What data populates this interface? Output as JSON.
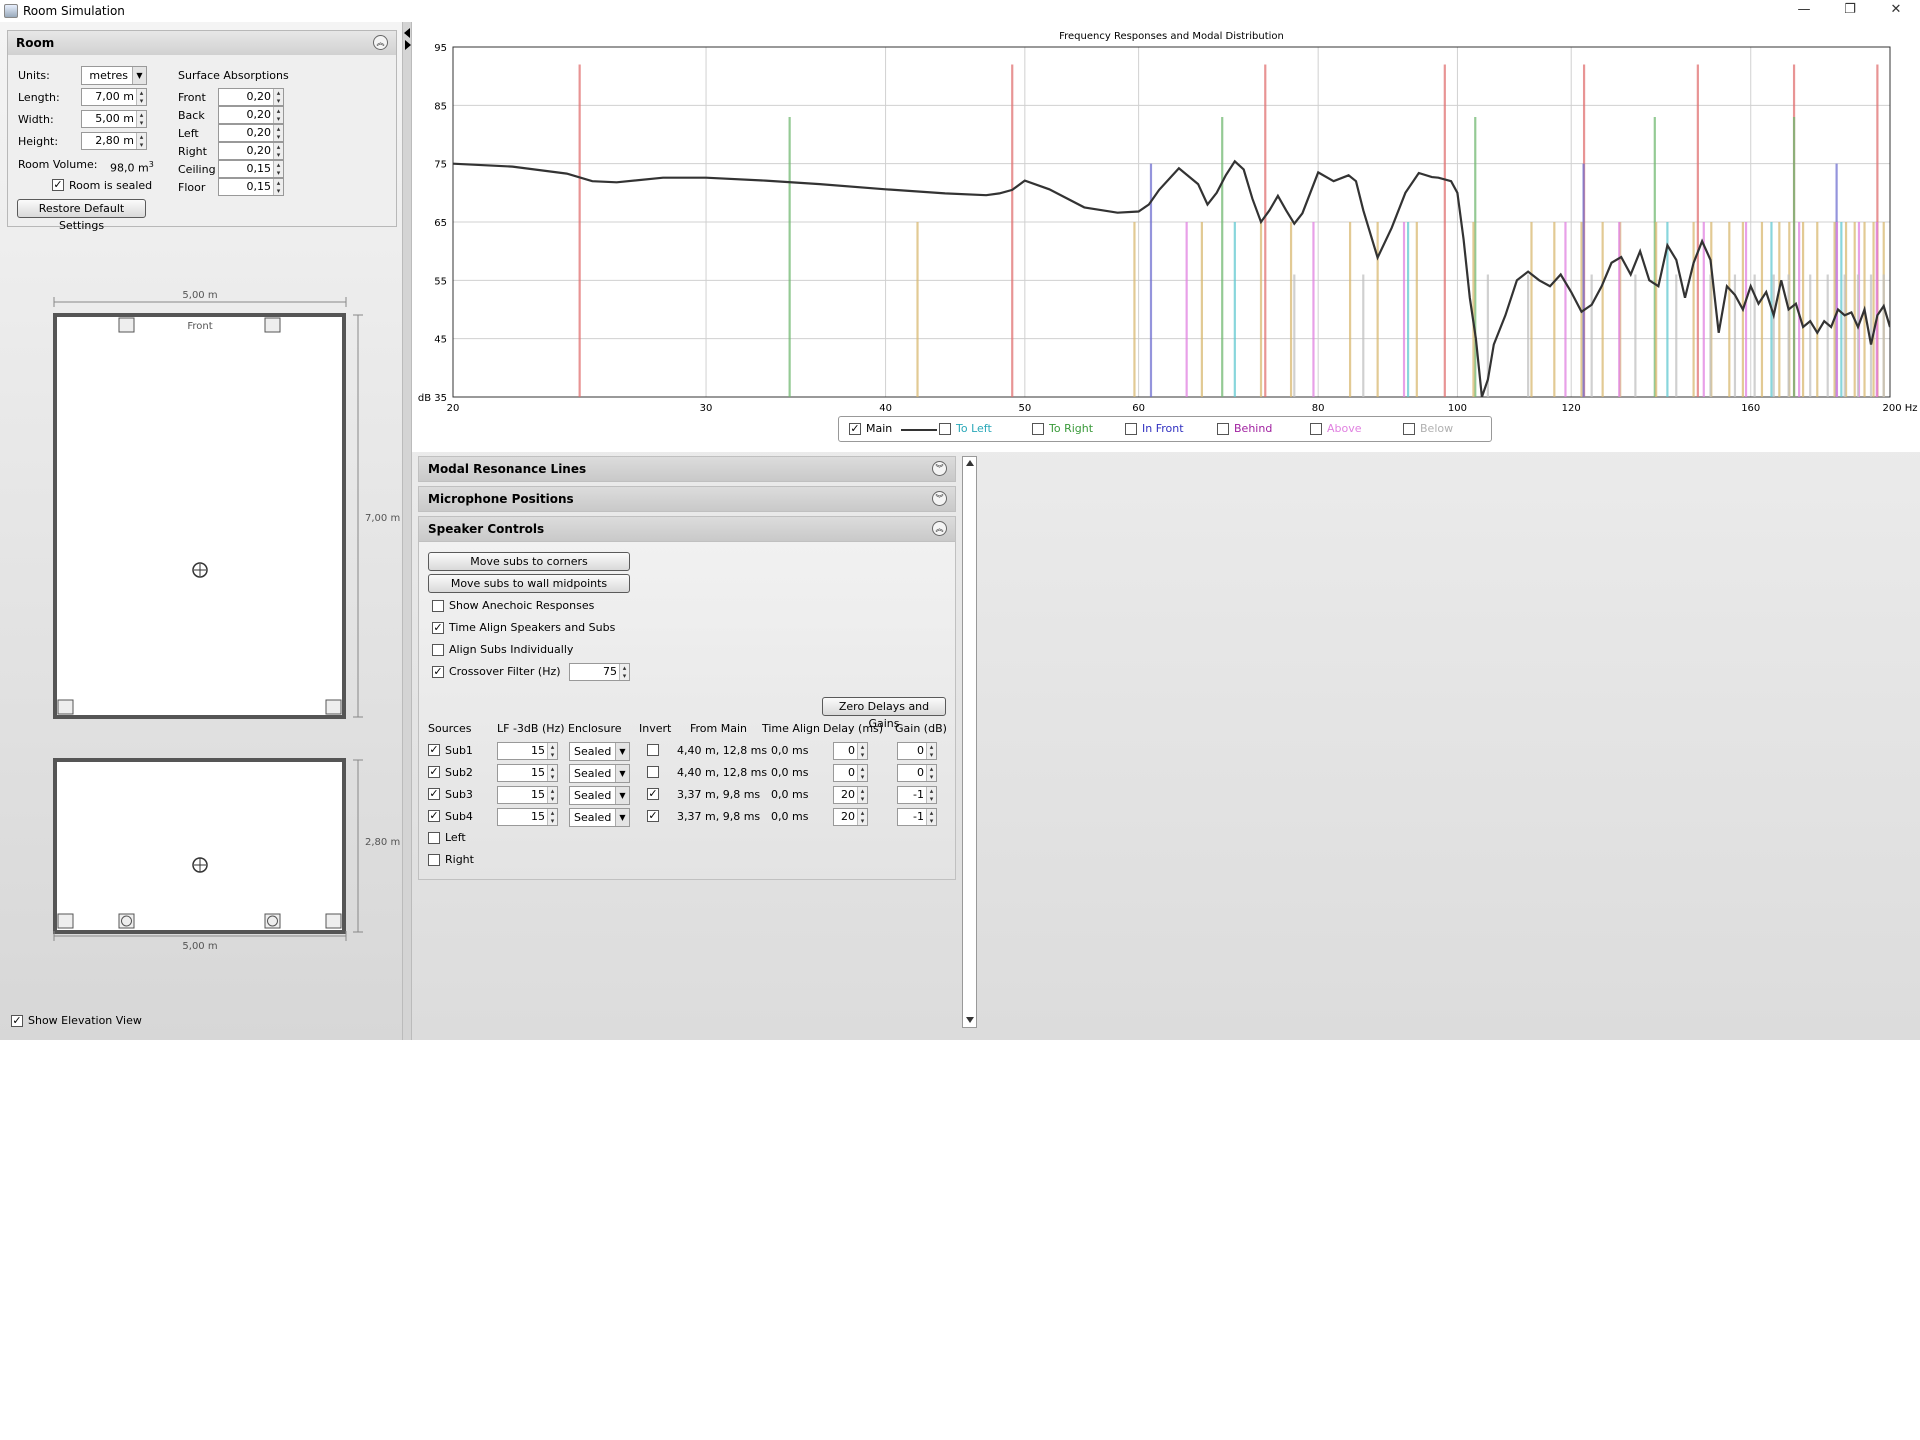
{
  "window": {
    "title": "Room Simulation",
    "min": "—",
    "restore": "❐",
    "close": "✕"
  },
  "room_panel": {
    "title": "Room",
    "units_label": "Units:",
    "units_value": "metres",
    "length_label": "Length:",
    "length_value": "7,00 m",
    "width_label": "Width:",
    "width_value": "5,00 m",
    "height_label": "Height:",
    "height_value": "2,80 m",
    "volume_label": "Room Volume:",
    "volume_value": "98,0 m",
    "volume_sup": "3",
    "sealed_label": "Room is sealed",
    "sealed_checked": true,
    "restore_button": "Restore Default Settings",
    "absorptions_title": "Surface Absorptions",
    "absorptions": [
      {
        "label": "Front",
        "value": "0,20"
      },
      {
        "label": "Back",
        "value": "0,20"
      },
      {
        "label": "Left",
        "value": "0,20"
      },
      {
        "label": "Right",
        "value": "0,20"
      },
      {
        "label": "Ceiling",
        "value": "0,15"
      },
      {
        "label": "Floor",
        "value": "0,15"
      }
    ]
  },
  "plan_view": {
    "width_label": "5,00 m",
    "length_label": "7,00 m",
    "front_label": "Front"
  },
  "elevation_view": {
    "height_label": "2,80 m",
    "width_label": "5,00 m"
  },
  "show_elevation": {
    "label": "Show Elevation View",
    "checked": true
  },
  "chart_data": {
    "type": "line",
    "title": "Frequency Responses and Modal Distribution",
    "ylabel": "dB",
    "xlabel": "",
    "x_scale": "log",
    "xlim": [
      20,
      200
    ],
    "ylim": [
      35,
      95
    ],
    "x_ticks": [
      "20",
      "30",
      "40",
      "50",
      "60",
      "80",
      "100",
      "120",
      "160",
      "200 Hz"
    ],
    "y_ticks": [
      "95",
      "85",
      "75",
      "65",
      "55",
      "45",
      "dB 35"
    ],
    "grid": true,
    "series": [
      {
        "name": "Main",
        "color": "#333333",
        "x": [
          20,
          22,
          24,
          25,
          26,
          28,
          30,
          33,
          36,
          40,
          44,
          47,
          48,
          49,
          50,
          52,
          55,
          58,
          60,
          61,
          62,
          64,
          66,
          67,
          68,
          69,
          70,
          71,
          72,
          73,
          74,
          75,
          76,
          77,
          78,
          79,
          80,
          82,
          84,
          85,
          86,
          88,
          90,
          92,
          94,
          96,
          97,
          99,
          100,
          101,
          102,
          103,
          104,
          105,
          106,
          108,
          110,
          112,
          114,
          116,
          118,
          120,
          122,
          124,
          126,
          128,
          130,
          132,
          134,
          136,
          138,
          140,
          142,
          144,
          146,
          148,
          150,
          152,
          154,
          156,
          158,
          160,
          162,
          164,
          166,
          168,
          170,
          172,
          174,
          176,
          178,
          180,
          182,
          184,
          186,
          188,
          190,
          192,
          194,
          196,
          198,
          200
        ],
        "y": [
          75,
          74.5,
          73.3,
          72,
          71.8,
          72.6,
          72.6,
          72.1,
          71.5,
          70.6,
          69.9,
          69.6,
          69.9,
          70.5,
          72.1,
          70.6,
          67.5,
          66.6,
          66.8,
          68,
          70.5,
          74.2,
          71.5,
          68,
          70,
          73,
          75.4,
          74,
          69,
          65,
          67,
          69.5,
          67,
          64.7,
          66.5,
          70,
          73.5,
          72,
          73,
          72,
          67,
          58.9,
          64,
          70,
          73.4,
          72.7,
          72.6,
          72,
          70,
          62,
          52,
          45,
          34,
          38,
          44,
          49,
          55,
          56.5,
          55,
          54,
          56,
          53,
          49.6,
          50.8,
          54,
          58,
          59,
          56,
          60,
          55,
          54,
          61,
          58.5,
          52,
          58,
          61.7,
          58.5,
          46,
          54,
          52.5,
          50,
          54,
          51,
          53,
          49,
          55,
          50,
          51,
          47,
          48,
          46,
          48,
          47,
          50,
          49,
          49.5,
          47,
          50,
          44,
          49,
          50.6,
          47
        ]
      },
      {
        "name": "To Left",
        "visible": false
      },
      {
        "name": "To Right",
        "visible": false
      },
      {
        "name": "In Front",
        "visible": false
      },
      {
        "name": "Behind",
        "visible": false
      },
      {
        "name": "Above",
        "visible": false
      },
      {
        "name": "Below",
        "visible": false
      }
    ],
    "modal_lines": [
      {
        "color": "#e07070",
        "top": 92,
        "x": [
          24.5,
          49,
          73.5,
          98,
          122.5,
          147,
          171.5,
          196
        ]
      },
      {
        "color": "#70b870",
        "top": 83,
        "x": [
          34.3,
          68.6,
          102.9,
          137.2,
          171.5
        ]
      },
      {
        "color": "#d8b870",
        "top": 65,
        "x": [
          42.1,
          59.6,
          66.4,
          73,
          76.6,
          84.2,
          88,
          93.7,
          102.6,
          112.6,
          116.8,
          122,
          126.2,
          129.8,
          137.5,
          146,
          150.2,
          154.6,
          158,
          162.9,
          167.5,
          170.2,
          174,
          178,
          183,
          186.4,
          189,
          192,
          194.8,
          198
        ]
      },
      {
        "color": "#7070d0",
        "top": 75,
        "x": [
          61.2,
          122.4,
          183.6
        ]
      },
      {
        "color": "#e080e0",
        "top": 65,
        "x": [
          64.8,
          79.4,
          91.8,
          118.9,
          129.6,
          148.4,
          158.8,
          172.9,
          183.7,
          190.3,
          195.8
        ]
      },
      {
        "color": "#60c8d0",
        "top": 65,
        "x": [
          70,
          92.4,
          140,
          165.4,
          185
        ]
      },
      {
        "color": "#c0c0c0",
        "top": 56,
        "x": [
          77,
          86,
          105,
          112,
          124,
          133,
          142,
          150,
          156,
          161,
          166,
          170,
          176,
          181,
          186,
          190,
          194,
          198
        ]
      }
    ],
    "legend": [
      {
        "label": "Main",
        "checked": true,
        "color": "#000000"
      },
      {
        "label": "To Left",
        "checked": false,
        "color": "#2aa8b8"
      },
      {
        "label": "To Right",
        "checked": false,
        "color": "#3a9a3a"
      },
      {
        "label": "In Front",
        "checked": false,
        "color": "#3030c0"
      },
      {
        "label": "Behind",
        "checked": false,
        "color": "#a020a0"
      },
      {
        "label": "Above",
        "checked": false,
        "color": "#e080e0"
      },
      {
        "label": "Below",
        "checked": false,
        "color": "#b0b0b0"
      }
    ]
  },
  "sections": {
    "modal": "Modal Resonance Lines",
    "mic": "Microphone Positions",
    "speaker": "Speaker Controls"
  },
  "speaker": {
    "btn_corners": "Move subs to corners",
    "btn_midpoints": "Move subs to wall midpoints",
    "anechoic": {
      "label": "Show Anechoic Responses",
      "checked": false
    },
    "time_align": {
      "label": "Time Align Speakers and Subs",
      "checked": true
    },
    "align_subs": {
      "label": "Align Subs Individually",
      "checked": false
    },
    "crossover": {
      "label": "Crossover Filter (Hz)",
      "checked": true,
      "value": "75"
    },
    "zero_button": "Zero Delays and Gains",
    "headers": [
      "Sources",
      "LF -3dB (Hz)",
      "Enclosure",
      "Invert",
      "From Main",
      "Time Align",
      "Delay (ms)",
      "Gain (dB)"
    ],
    "rows": [
      {
        "name": "Sub1",
        "checked": true,
        "lf": "15",
        "enc": "Sealed",
        "invert": false,
        "from": "4,40 m, 12,8 ms",
        "ta": "0,0 ms",
        "delay": "0",
        "gain": "0"
      },
      {
        "name": "Sub2",
        "checked": true,
        "lf": "15",
        "enc": "Sealed",
        "invert": false,
        "from": "4,40 m, 12,8 ms",
        "ta": "0,0 ms",
        "delay": "0",
        "gain": "0"
      },
      {
        "name": "Sub3",
        "checked": true,
        "lf": "15",
        "enc": "Sealed",
        "invert": true,
        "from": "3,37 m, 9,8 ms",
        "ta": "0,0 ms",
        "delay": "20",
        "gain": "-1"
      },
      {
        "name": "Sub4",
        "checked": true,
        "lf": "15",
        "enc": "Sealed",
        "invert": true,
        "from": "3,37 m, 9,8 ms",
        "ta": "0,0 ms",
        "delay": "20",
        "gain": "-1"
      }
    ],
    "left": {
      "label": "Left",
      "checked": false
    },
    "right": {
      "label": "Right",
      "checked": false
    }
  },
  "icons": {
    "collapse_up": "︽",
    "collapse_down": "︾",
    "check": "✓",
    "dropdown": "▼"
  }
}
